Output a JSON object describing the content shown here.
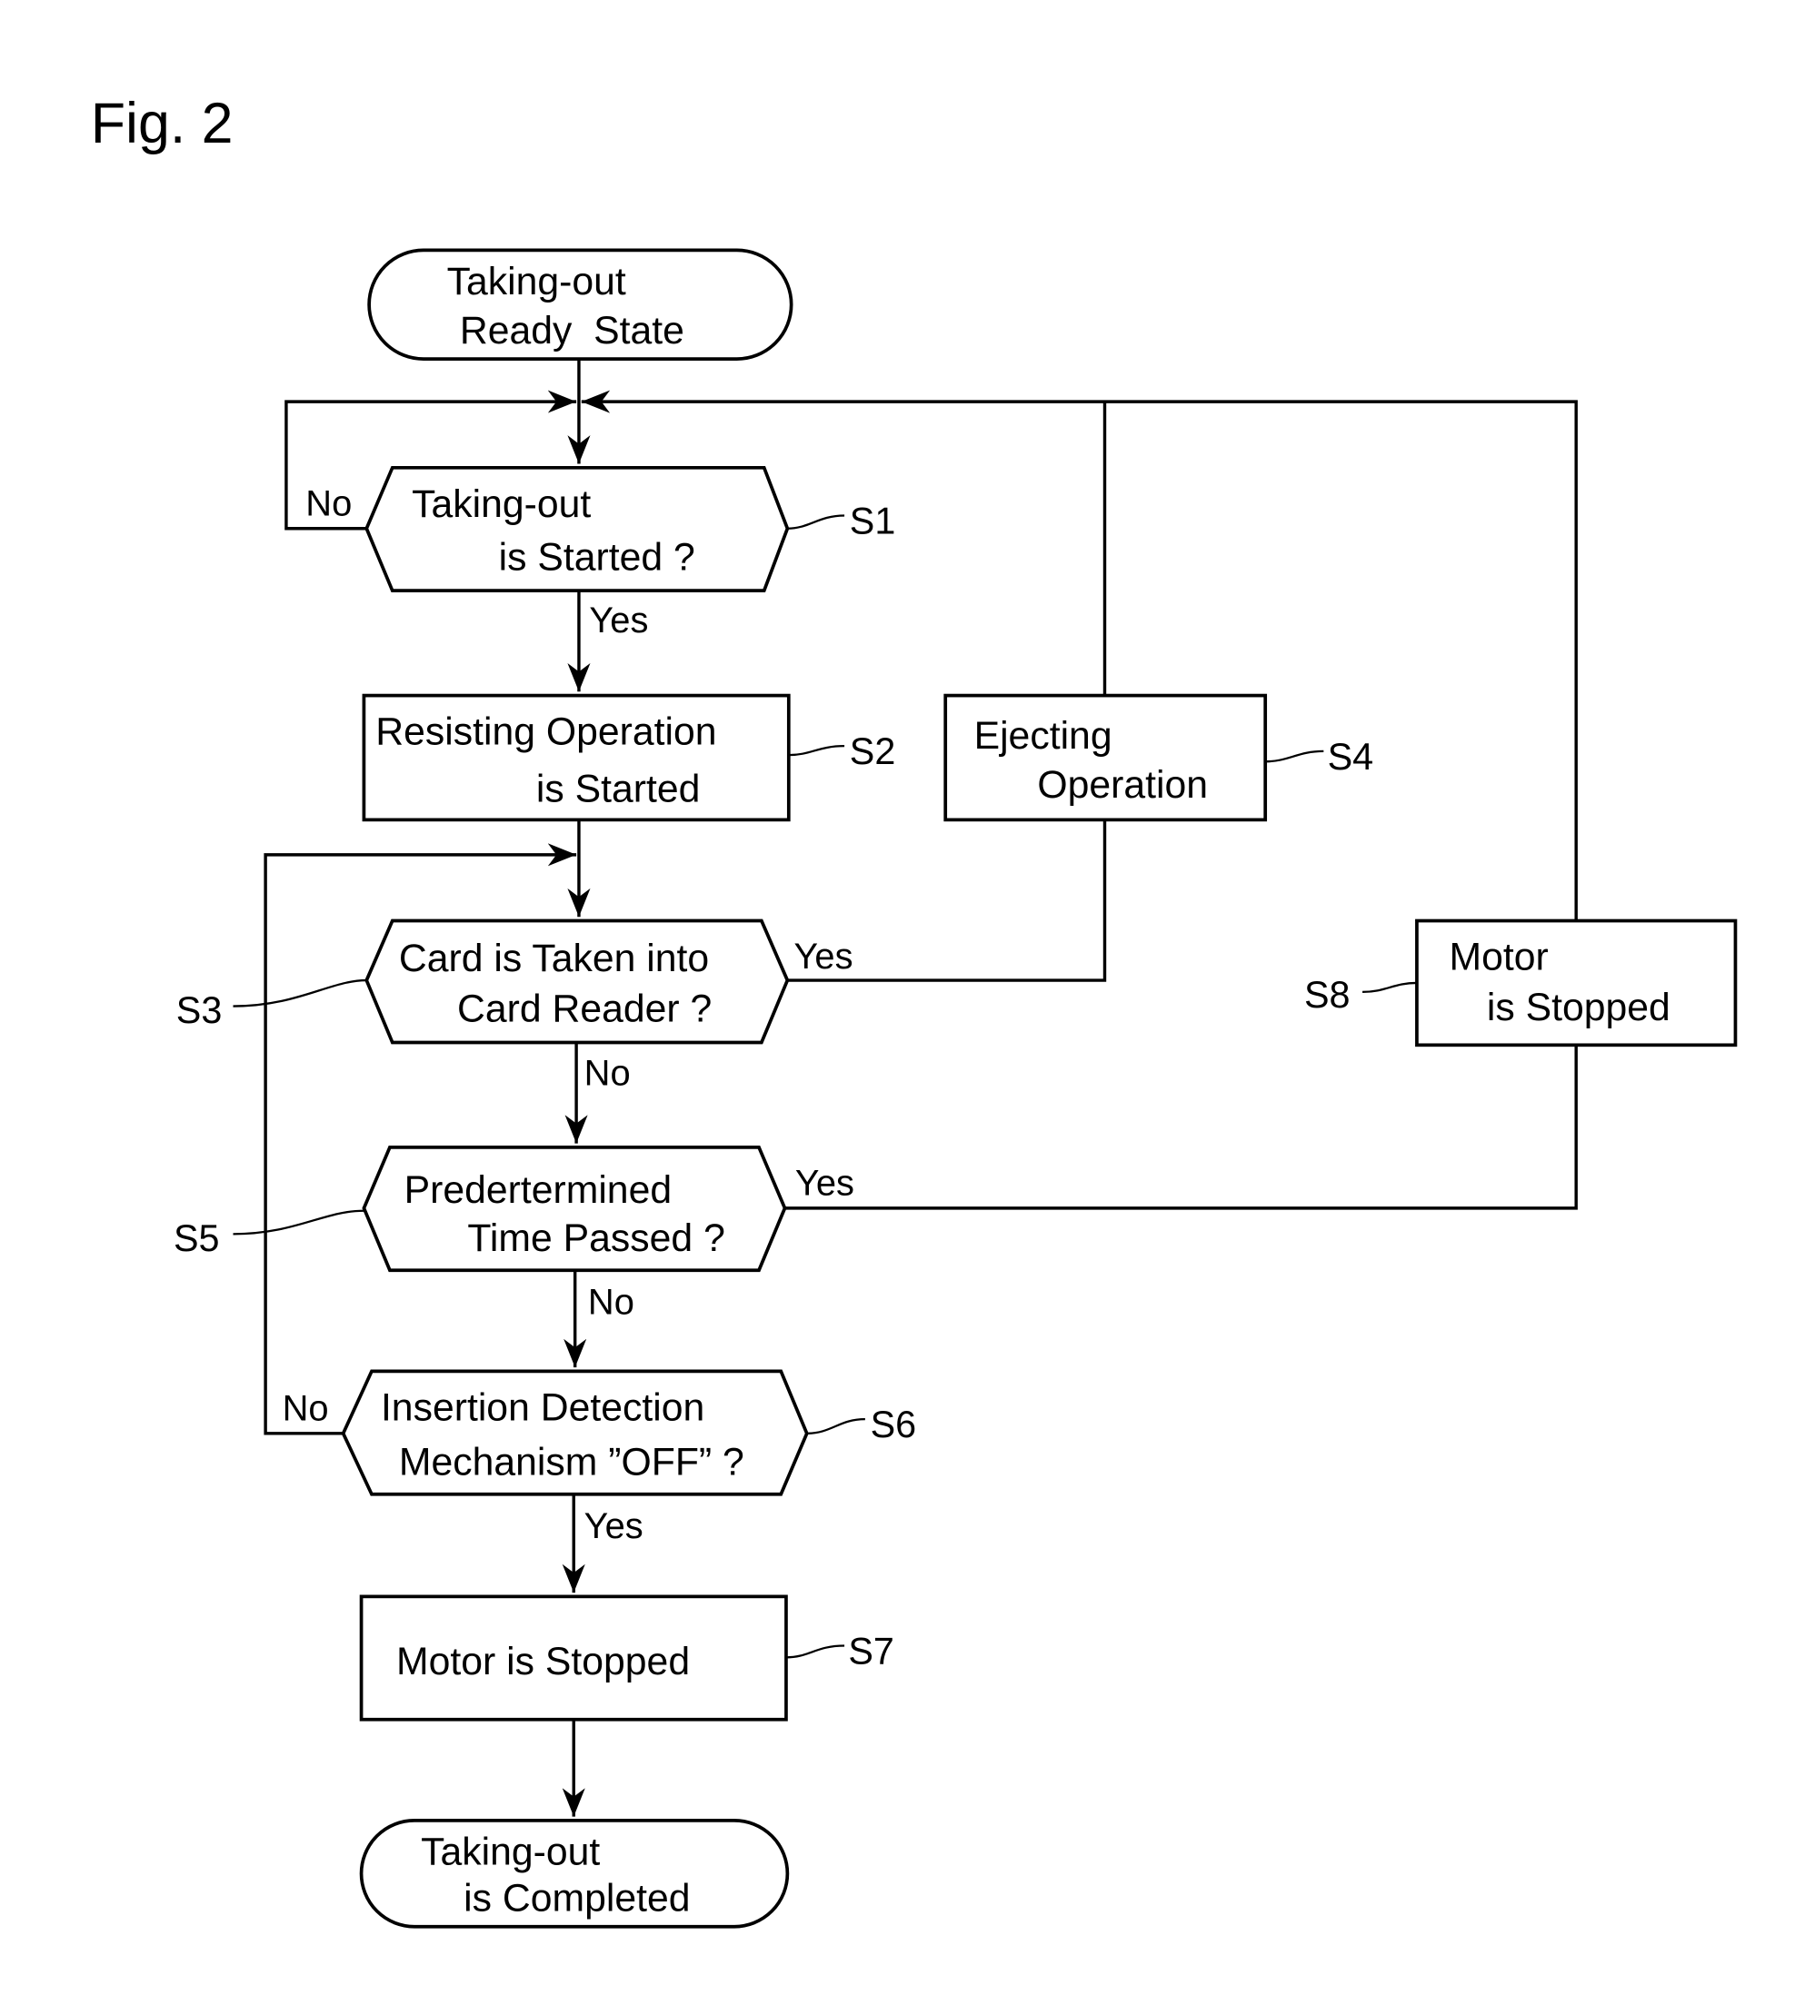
{
  "figure": {
    "title": "Fig. 2"
  },
  "nodes": {
    "start": {
      "type": "terminal",
      "lines": [
        "Taking-out",
        "Ready  State"
      ]
    },
    "s1": {
      "type": "decision",
      "step": "S1",
      "lines": [
        "Taking-out",
        "is Started ?"
      ]
    },
    "s2": {
      "type": "process",
      "step": "S2",
      "lines": [
        "Resisting Operation",
        "is Started"
      ]
    },
    "s3": {
      "type": "decision",
      "step": "S3",
      "lines": [
        "Card is Taken into",
        "Card Reader ?"
      ]
    },
    "s4": {
      "type": "process",
      "step": "S4",
      "lines": [
        "Ejecting",
        "Operation"
      ]
    },
    "s5": {
      "type": "decision",
      "step": "S5",
      "lines": [
        "Predertermined",
        "Time Passed ?"
      ]
    },
    "s6": {
      "type": "decision",
      "step": "S6",
      "lines": [
        "Insertion Detection",
        "Mechanism ”OFF” ?"
      ]
    },
    "s7": {
      "type": "process",
      "step": "S7",
      "lines": [
        "Motor is Stopped"
      ]
    },
    "s8": {
      "type": "process",
      "step": "S8",
      "lines": [
        "Motor",
        "is Stopped"
      ]
    },
    "end": {
      "type": "terminal",
      "lines": [
        "Taking-out",
        "is Completed"
      ]
    }
  },
  "edges": [
    {
      "from": "start",
      "to": "s1",
      "label": ""
    },
    {
      "from": "s1",
      "to": "s1",
      "label": "No"
    },
    {
      "from": "s1",
      "to": "s2",
      "label": "Yes"
    },
    {
      "from": "s2",
      "to": "s3",
      "label": ""
    },
    {
      "from": "s3",
      "to": "s4",
      "label": "Yes"
    },
    {
      "from": "s4",
      "to": "s1",
      "label": ""
    },
    {
      "from": "s3",
      "to": "s5",
      "label": "No"
    },
    {
      "from": "s5",
      "to": "s8",
      "label": "Yes"
    },
    {
      "from": "s8",
      "to": "s1",
      "label": ""
    },
    {
      "from": "s5",
      "to": "s6",
      "label": "No"
    },
    {
      "from": "s6",
      "to": "s3",
      "label": "No"
    },
    {
      "from": "s6",
      "to": "s7",
      "label": "Yes"
    },
    {
      "from": "s7",
      "to": "end",
      "label": ""
    }
  ]
}
